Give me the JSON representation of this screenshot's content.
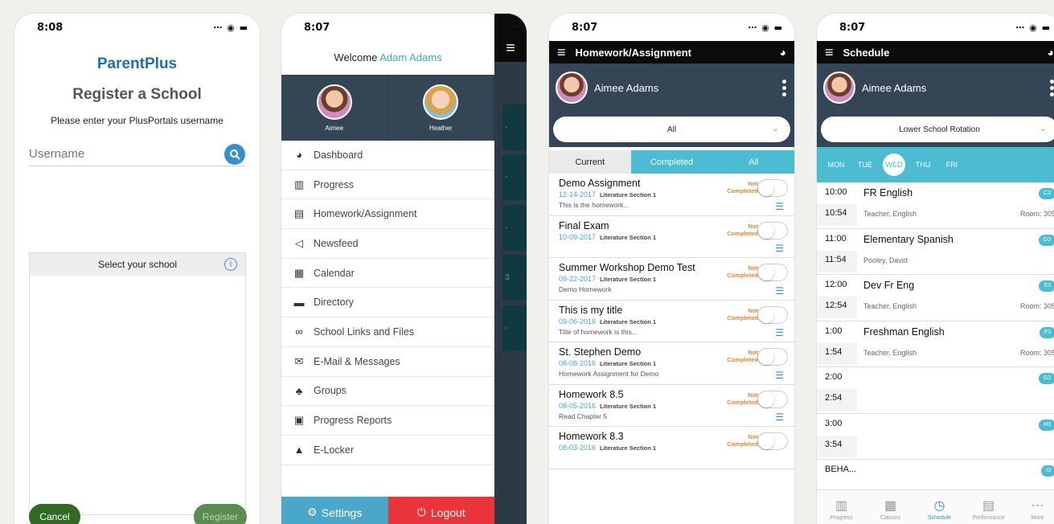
{
  "screen1": {
    "time": "8:08",
    "brand": "ParentPlus",
    "title": "Register a School",
    "subtitle": "Please enter your PlusPortals username",
    "username_placeholder": "Username",
    "select_school": "Select your school",
    "info_icon": "i",
    "cancel": "Cancel",
    "register": "Register"
  },
  "screen2": {
    "time": "8:07",
    "welcome": "Welcome",
    "welcome_name": "Adam Adams",
    "kids": [
      {
        "name": "Aimee"
      },
      {
        "name": "Heather"
      }
    ],
    "menu": [
      {
        "icon": "dashboard-icon",
        "glyph": "◕",
        "label": "Dashboard"
      },
      {
        "icon": "progress-icon",
        "glyph": "▥",
        "label": "Progress"
      },
      {
        "icon": "homework-icon",
        "glyph": "▤",
        "label": "Homework/Assignment"
      },
      {
        "icon": "newsfeed-icon",
        "glyph": "◁",
        "label": "Newsfeed"
      },
      {
        "icon": "calendar-icon",
        "glyph": "▦",
        "label": "Calendar"
      },
      {
        "icon": "directory-icon",
        "glyph": "▬",
        "label": "Directory"
      },
      {
        "icon": "links-icon",
        "glyph": "∞",
        "label": "School Links and Files"
      },
      {
        "icon": "mail-icon",
        "glyph": "✉",
        "label": "E-Mail & Messages"
      },
      {
        "icon": "groups-icon",
        "glyph": "♣",
        "label": "Groups"
      },
      {
        "icon": "reports-icon",
        "glyph": "▣",
        "label": "Progress Reports"
      },
      {
        "icon": "lock-icon",
        "glyph": "▲",
        "label": "E-Locker"
      }
    ],
    "settings": "Settings",
    "logout": "Logout",
    "behind_tiles": [
      "-",
      "-",
      "-",
      "3",
      "-"
    ]
  },
  "screen3": {
    "time": "8:07",
    "title": "Homework/Assignment",
    "student": "Aimee Adams",
    "filter": "All",
    "tabs": [
      "Current",
      "Completed",
      "All"
    ],
    "status_line1": "Not",
    "status_line2": "Completed",
    "items": [
      {
        "title": "Demo Assignment",
        "date": "12-14-2017",
        "section": "Literature Section 1",
        "desc": "This is the homework..."
      },
      {
        "title": "Final Exam",
        "date": "10-09-2017",
        "section": "Literature Section 1",
        "desc": ""
      },
      {
        "title": "Summer Workshop Demo Test",
        "date": "09-22-2017",
        "section": "Literature Section 1",
        "desc": "Demo Homework"
      },
      {
        "title": "This is my title",
        "date": "09-06-2016",
        "section": "Literature Section 1",
        "desc": "Title of homework is this..."
      },
      {
        "title": "St. Stephen Demo",
        "date": "08-08-2016",
        "section": "Literature Section 1",
        "desc": "Homework Assignment for Demo"
      },
      {
        "title": "Homework 8.5",
        "date": "08-05-2016",
        "section": "Literature Section 1",
        "desc": "Read Chapter 5"
      },
      {
        "title": "Homework 8.3",
        "date": "08-03-2016",
        "section": "Literature Section 1",
        "desc": ""
      }
    ]
  },
  "screen4": {
    "time": "8:07",
    "title": "Schedule",
    "student": "Aimee Adams",
    "rotation": "Lower School Rotation",
    "days": [
      "MON",
      "TUE",
      "WED",
      "THU",
      "FRI"
    ],
    "periods": [
      {
        "start": "10:00",
        "end": "10:54",
        "class": "FR English",
        "teacher": "Teacher, English",
        "room": "Room: 305",
        "badge": "C3"
      },
      {
        "start": "11:00",
        "end": "11:54",
        "class": "Elementary Spanish",
        "teacher": "Pooley, David",
        "room": "",
        "badge": "D3"
      },
      {
        "start": "12:00",
        "end": "12:54",
        "class": "Dev Fr Eng",
        "teacher": "Teacher, English",
        "room": "Room: 305",
        "badge": "E3"
      },
      {
        "start": "1:00",
        "end": "1:54",
        "class": "Freshman English",
        "teacher": "Teacher, English",
        "room": "Room: 305",
        "badge": "F3"
      },
      {
        "start": "2:00",
        "end": "2:54",
        "class": "",
        "teacher": "",
        "room": "",
        "badge": "G3"
      },
      {
        "start": "3:00",
        "end": "3:54",
        "class": "",
        "teacher": "",
        "room": "",
        "badge": "H3"
      },
      {
        "start": "BEHA...",
        "end": "",
        "class": "",
        "teacher": "",
        "room": "",
        "badge": "I3"
      }
    ],
    "tabs": [
      "Progress",
      "Classes",
      "Schedule",
      "Performance",
      "More"
    ]
  }
}
